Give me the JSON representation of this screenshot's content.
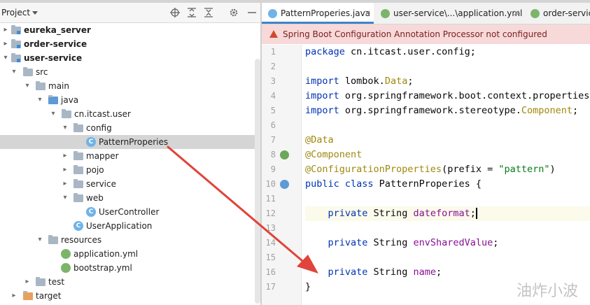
{
  "colors": {
    "accent": "#4083c9",
    "banner_bg": "#f7d9d9",
    "arrow": "#e0443a"
  },
  "project_panel": {
    "title": "Project",
    "tree": [
      {
        "label": "eureka_server",
        "bold": true,
        "kind": "module",
        "expanded": false
      },
      {
        "label": "order-service",
        "bold": true,
        "kind": "module",
        "expanded": false
      },
      {
        "label": "user-service",
        "bold": true,
        "kind": "module",
        "expanded": true
      },
      {
        "label": "src",
        "kind": "folder",
        "expanded": true
      },
      {
        "label": "main",
        "kind": "folder",
        "expanded": true
      },
      {
        "label": "java",
        "kind": "folder-blue",
        "expanded": true
      },
      {
        "label": "cn.itcast.user",
        "kind": "package",
        "expanded": true
      },
      {
        "label": "config",
        "kind": "package",
        "expanded": true
      },
      {
        "label": "PatternProperies",
        "kind": "class",
        "selected": true
      },
      {
        "label": "mapper",
        "kind": "package",
        "expanded": false
      },
      {
        "label": "pojo",
        "kind": "package",
        "expanded": false
      },
      {
        "label": "service",
        "kind": "package",
        "expanded": false
      },
      {
        "label": "web",
        "kind": "package",
        "expanded": true
      },
      {
        "label": "UserController",
        "kind": "class"
      },
      {
        "label": "UserApplication",
        "kind": "spring-class"
      },
      {
        "label": "resources",
        "kind": "folder-res",
        "expanded": true
      },
      {
        "label": "application.yml",
        "kind": "yml"
      },
      {
        "label": "bootstrap.yml",
        "kind": "yml"
      },
      {
        "label": "test",
        "kind": "folder",
        "expanded": false
      },
      {
        "label": "target",
        "kind": "folder-orange",
        "expanded": false
      }
    ]
  },
  "tabs": [
    {
      "label": "PatternProperies.java",
      "active": true,
      "icon": "class-icon"
    },
    {
      "label": "user-service\\...\\application.yml",
      "active": false,
      "icon": "yml-icon"
    },
    {
      "label": "order-service",
      "active": false,
      "icon": "yml-icon"
    }
  ],
  "banner": {
    "text": "Spring Boot Configuration Annotation Processor not configured",
    "icon": "warning-icon"
  },
  "code": {
    "line_numbers": [
      "1",
      "2",
      "3",
      "4",
      "5",
      "6",
      "7",
      "8",
      "9",
      "10",
      "11",
      "12",
      "13",
      "14",
      "15",
      "16",
      "17"
    ],
    "lines": {
      "l1_kw": "package",
      "l1_rest": " cn.itcast.user.config;",
      "l3_kw": "import",
      "l3_a": " lombok.",
      "l3_b": "Data",
      "l3_c": ";",
      "l4_kw": "import",
      "l4_a": " org.springframework.boot.context.properties.",
      "l5_kw": "import",
      "l5_a": " org.springframework.stereotype.",
      "l5_b": "Component",
      "l5_c": ";",
      "l7": "@Data",
      "l8": "@Component",
      "l9_ann": "@ConfigurationProperties",
      "l9_a": "(prefix = ",
      "l9_str": "\"pattern\"",
      "l9_b": ")",
      "l10_kw": "public class",
      "l10_rest": " PatternProperies {",
      "l12_kw": "private",
      "l12_a": " String ",
      "l12_f": "dateformat",
      "l12_b": ";",
      "l14_kw": "private",
      "l14_a": " String ",
      "l14_f": "envSharedValue",
      "l14_b": ";",
      "l16_kw": "private",
      "l16_a": " String ",
      "l16_f": "name",
      "l16_b": ";",
      "l17": "}"
    }
  },
  "watermark": "油炸小波"
}
